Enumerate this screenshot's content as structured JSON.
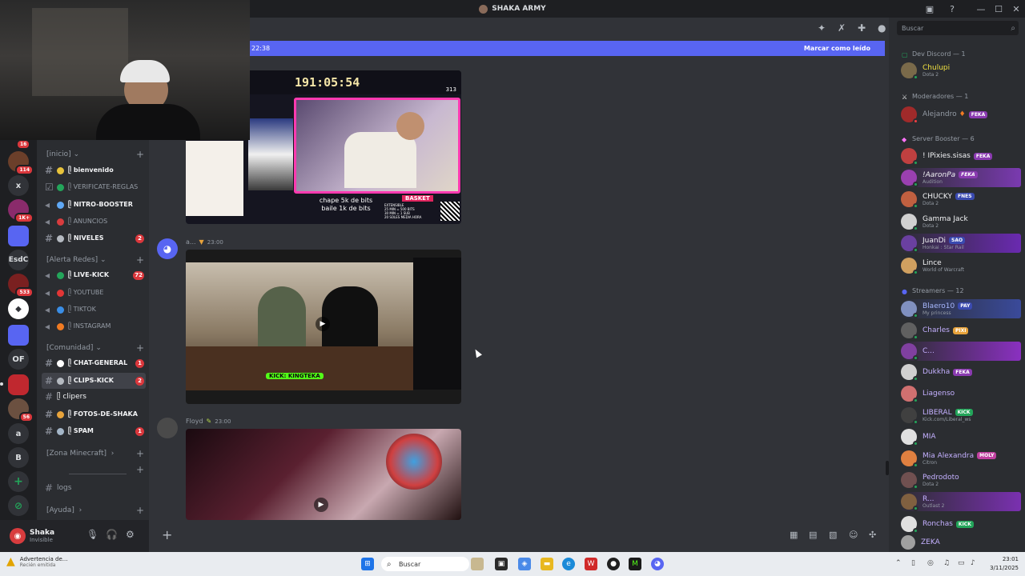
{
  "window": {
    "title": "SHAKA ARMY",
    "minimize": "—",
    "maximize": "☐",
    "close": "✕"
  },
  "guilds": {
    "items": [
      {
        "label": "",
        "badge": "114",
        "color": "#6b3f2a"
      },
      {
        "label": "x",
        "badge": "",
        "color": "#313338"
      },
      {
        "label": "",
        "badge": "1K+",
        "color": "#8a2b6b"
      },
      {
        "label": "",
        "badge": "",
        "color": "#5865f2"
      },
      {
        "label": "EsdC",
        "badge": "",
        "color": "#313338"
      },
      {
        "label": "",
        "badge": "533",
        "color": "#7a2020"
      },
      {
        "label": "",
        "badge": "",
        "color": "#ffffff"
      },
      {
        "label": "",
        "badge": "",
        "color": "#5865f2"
      },
      {
        "label": "OF",
        "badge": "",
        "color": "#313338"
      },
      {
        "label": "",
        "badge": "",
        "color": "#c0282f"
      },
      {
        "label": "",
        "badge": "56",
        "color": "#6b5040"
      },
      {
        "label": "a",
        "badge": "",
        "color": "#313338"
      },
      {
        "label": "B",
        "badge": "",
        "color": "#313338"
      },
      {
        "label": "+",
        "badge": "",
        "color": "#313338"
      },
      {
        "label": "⊘",
        "badge": "",
        "color": "#313338"
      }
    ],
    "top_badge": "16"
  },
  "sidebar": {
    "categories": [
      {
        "label": "[inicio]",
        "chevron": "⌄"
      },
      {
        "label": "[Alerta Redes]",
        "chevron": "⌄"
      },
      {
        "label": "[Comunidad]",
        "chevron": "⌄"
      },
      {
        "label": "[Zona Minecraft]",
        "chevron": "›"
      },
      {
        "label": "[Ayuda]",
        "chevron": "›"
      }
    ],
    "channels": [
      {
        "label": "ᥫ bienvenido",
        "bold": true,
        "icon": "#",
        "emoji": "#e8c33b",
        "unread": ""
      },
      {
        "label": "ᥫ VERIFICATE-REGLAS",
        "bold": false,
        "icon": "☑",
        "emoji": "#23a55a",
        "unread": ""
      },
      {
        "label": "ᥫ NITRO-BOOSTER",
        "bold": true,
        "icon": "🔊",
        "emoji": "#5fa8f5",
        "unread": ""
      },
      {
        "label": "ᥫ ANUNCIOS",
        "bold": false,
        "icon": "🔊",
        "emoji": "#d83c3e",
        "unread": ""
      },
      {
        "label": "ᥫ NIVELES",
        "bold": true,
        "icon": "#",
        "emoji": "#b5bac1",
        "unread": "2"
      },
      {
        "label": "ᥫ LIVE-KICK",
        "bold": true,
        "icon": "🔊",
        "emoji": "#23a55a",
        "unread": "72"
      },
      {
        "label": "ᥫ YOUTUBE",
        "bold": false,
        "icon": "🔊",
        "emoji": "#e23636",
        "unread": ""
      },
      {
        "label": "ᥫ TIKTOK",
        "bold": false,
        "icon": "🔊",
        "emoji": "#3a8ee6",
        "unread": ""
      },
      {
        "label": "ᥫ INSTAGRAM",
        "bold": false,
        "icon": "🔊",
        "emoji": "#f07b22",
        "unread": ""
      },
      {
        "label": "ᥫ CHAT-GENERAL",
        "bold": true,
        "icon": "#",
        "emoji": "#ffffff",
        "unread": "1"
      },
      {
        "label": "ᥫ CLIPS-KICK",
        "bold": true,
        "icon": "#",
        "emoji": "#b5bac1",
        "unread": "2"
      },
      {
        "label": "ᥫ clipers",
        "bold": true,
        "icon": "#",
        "emoji": "",
        "unread": ""
      },
      {
        "label": "ᥫ FOTOS-DE-SHAKA",
        "bold": true,
        "icon": "#",
        "emoji": "#e8a33b",
        "unread": ""
      },
      {
        "label": "ᥫ SPAM",
        "bold": true,
        "icon": "#",
        "emoji": "#a4b6c8",
        "unread": "1"
      },
      {
        "label": "logs",
        "bold": false,
        "icon": "#",
        "emoji": "",
        "unread": ""
      }
    ]
  },
  "user": {
    "name": "Shaka",
    "status": "Invisible"
  },
  "chat": {
    "new_messages_time": "22:38",
    "mark_read": "Marcar como leído",
    "messages": [
      {
        "author": "a...",
        "time": "23:00"
      },
      {
        "author": "Floyd",
        "time": "23:00"
      }
    ],
    "video1": {
      "timer": "191:05:54",
      "counter": "313",
      "caption": "chape 5k de bits\nbaile 1k de bits",
      "basket": "BASKET",
      "basket_text": "EXTENSIBLE\n25 MIN = 500 BITS\n30 MIN = 1 SUB\n20 SOLES MEDIA HORA"
    },
    "video2": {
      "overlay_label": "KICK: KINGTEKA"
    }
  },
  "members": {
    "search_placeholder": "Buscar",
    "groups": [
      {
        "label": "Dev Discord — 1"
      },
      {
        "label": "Moderadores — 1"
      },
      {
        "label": "Server Booster — 6"
      },
      {
        "label": "Streamers — 12"
      }
    ],
    "list": [
      {
        "name": "Chulupi",
        "status": "Dota 2",
        "color": "#f0e040",
        "tag": "",
        "avatar": "#7a6a4a"
      },
      {
        "name": "Alejandro",
        "status": "",
        "color": "#949ba4",
        "tag": "FEKA",
        "avatar": "#a02a2a"
      },
      {
        "name": "! IPixies.sisas",
        "status": "",
        "color": "#f2f3f5",
        "tag": "FEKA",
        "avatar": "#c04040"
      },
      {
        "name": "!AaronPa",
        "status": "Audition",
        "color": "#f2f3f5",
        "tag": "FEKA",
        "avatar": "#9a40b0"
      },
      {
        "name": "CHUCKY",
        "status": "Dota 2",
        "color": "#f2f3f5",
        "tag": "FNES",
        "avatar": "#c06040"
      },
      {
        "name": "Gamma Jack",
        "status": "Dota 2",
        "color": "#f2f3f5",
        "tag": "",
        "avatar": "#d0d0d0"
      },
      {
        "name": "JuanDi",
        "status": "Honkai : Star Rail",
        "color": "#f2f3f5",
        "tag": "SAO",
        "avatar": "#6a40a0"
      },
      {
        "name": "Lince",
        "status": "World of Warcraft",
        "color": "#f2f3f5",
        "tag": "",
        "avatar": "#d0a060"
      },
      {
        "name": "Blaero10",
        "status": "My princess",
        "color": "#a8b8ff",
        "tag": "PAY",
        "avatar": "#8090c0"
      },
      {
        "name": "Charles",
        "status": "",
        "color": "#c4b0ff",
        "tag": "PIXI",
        "avatar": "#606060"
      },
      {
        "name": "C...",
        "status": "",
        "color": "#c4b0ff",
        "tag": "",
        "avatar": "#8040a0"
      },
      {
        "name": "Dukkha",
        "status": "",
        "color": "#c4b0ff",
        "tag": "FEKA",
        "avatar": "#d0d0d0"
      },
      {
        "name": "Liagenso",
        "status": "",
        "color": "#c4b0ff",
        "tag": "",
        "avatar": "#d07070"
      },
      {
        "name": "LIBERAL",
        "status": "Kick.com/Liberal_ws",
        "color": "#c4b0ff",
        "tag": "KICK",
        "avatar": "#404040"
      },
      {
        "name": "MIA",
        "status": "",
        "color": "#c4b0ff",
        "tag": "",
        "avatar": "#e0e0e0"
      },
      {
        "name": "Mia Alexandra",
        "status": "Citron",
        "color": "#c4b0ff",
        "tag": "MOLY",
        "avatar": "#e08040"
      },
      {
        "name": "Pedrodoto",
        "status": "Dota 2",
        "color": "#c4b0ff",
        "tag": "",
        "avatar": "#705050"
      },
      {
        "name": "R...",
        "status": "Outlast 2",
        "color": "#c4b0ff",
        "tag": "",
        "avatar": "#806040"
      },
      {
        "name": "Ronchas",
        "status": "",
        "color": "#c4b0ff",
        "tag": "KICK",
        "avatar": "#e0e0e0"
      },
      {
        "name": "ZEKA",
        "status": "",
        "color": "#c4b0ff",
        "tag": "",
        "avatar": "#a0a0a0"
      }
    ]
  },
  "taskbar": {
    "notif_title": "Advertencia de...",
    "notif_sub": "Recién emitida",
    "search": "Buscar",
    "time": "23:01",
    "date": "3/11/2025"
  }
}
